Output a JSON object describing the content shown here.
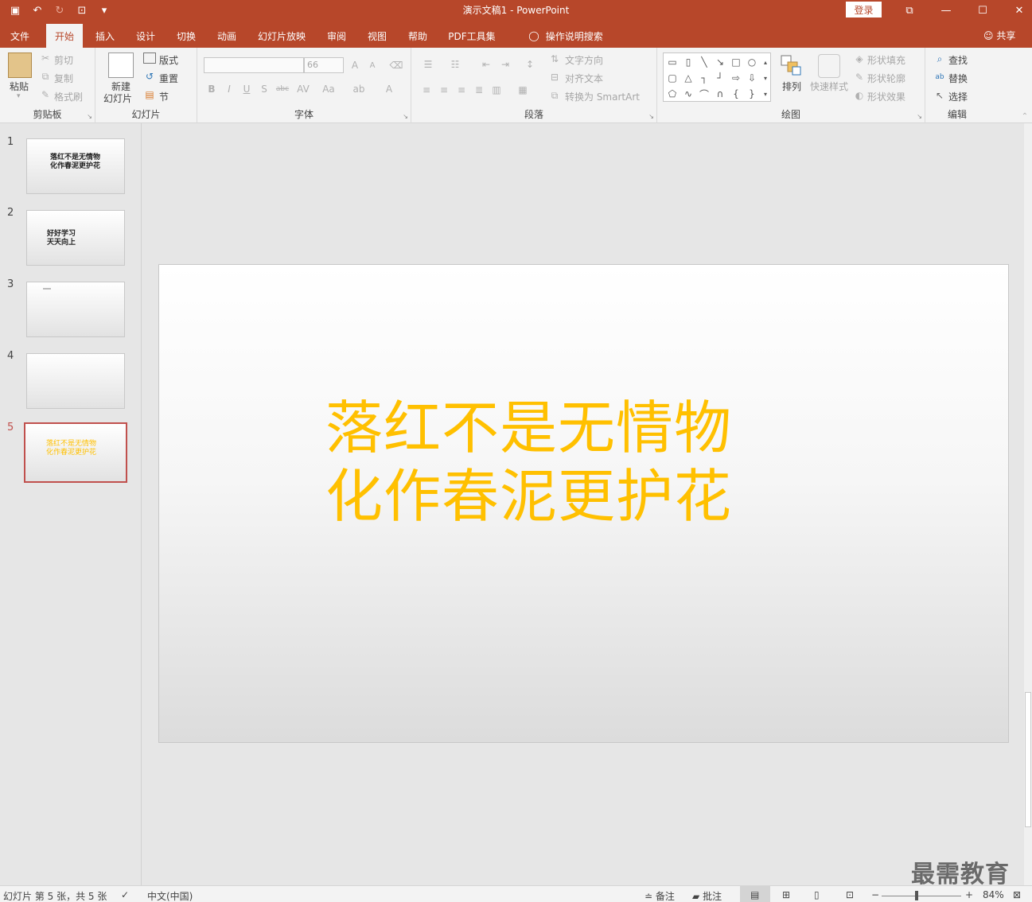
{
  "window": {
    "title": "演示文稿1 - PowerPoint",
    "signin": "登录",
    "minimize": "—",
    "maximize": "☐",
    "close": "✕",
    "ribbon_display": "⧉"
  },
  "qat": {
    "save": "▣",
    "undo": "↶",
    "redo": "↻",
    "present": "⊡",
    "customize": "▾"
  },
  "tabs": [
    {
      "label": "文件"
    },
    {
      "label": "开始"
    },
    {
      "label": "插入"
    },
    {
      "label": "设计"
    },
    {
      "label": "切换"
    },
    {
      "label": "动画"
    },
    {
      "label": "幻灯片放映"
    },
    {
      "label": "审阅"
    },
    {
      "label": "视图"
    },
    {
      "label": "帮助"
    },
    {
      "label": "PDF工具集"
    },
    {
      "label": "操作说明搜索"
    }
  ],
  "share": "共享",
  "ribbon": {
    "clipboard": {
      "label": "剪贴板",
      "paste": "粘贴",
      "cut": "剪切",
      "copy": "复制",
      "format_painter": "格式刷"
    },
    "slides": {
      "label": "幻灯片",
      "new_slide_line1": "新建",
      "new_slide_line2": "幻灯片",
      "layout": "版式",
      "reset": "重置",
      "section": "节"
    },
    "font": {
      "label": "字体",
      "font_name": "",
      "font_size": "66"
    },
    "paragraph": {
      "label": "段落",
      "text_direction": "文字方向",
      "align_text": "对齐文本",
      "convert_smartart": "转换为 SmartArt"
    },
    "drawing": {
      "label": "绘图",
      "arrange": "排列",
      "quick_styles": "快速样式",
      "shape_fill": "形状填充",
      "shape_outline": "形状轮廓",
      "shape_effects": "形状效果"
    },
    "editing": {
      "label": "编辑",
      "find": "查找",
      "replace": "替换",
      "select": "选择"
    }
  },
  "thumbnails": [
    {
      "num": "1",
      "lines": [
        "落红不是无情物",
        "化作春泥更护花"
      ],
      "color": "#222222"
    },
    {
      "num": "2",
      "lines": [
        "好好学习",
        "天天向上"
      ],
      "color": "#222222"
    },
    {
      "num": "3",
      "lines": [],
      "color": "#222222"
    },
    {
      "num": "4",
      "lines": [],
      "color": "#222222"
    },
    {
      "num": "5",
      "lines": [
        "落红不是无情物",
        "化作春泥更护花"
      ],
      "color": "#ffc000"
    }
  ],
  "slide": {
    "line1": "落红不是无情物",
    "line2": "化作春泥更护花",
    "text_color": "#ffc000"
  },
  "watermark": "最需教育",
  "status": {
    "slide_info": "幻灯片 第 5 张，共 5 张",
    "language": "中文(中国)",
    "notes": "备注",
    "comments": "批注",
    "zoom": "84%"
  },
  "colors": {
    "accent": "#b7472a",
    "selected_thumb_border": "#c0504d"
  }
}
